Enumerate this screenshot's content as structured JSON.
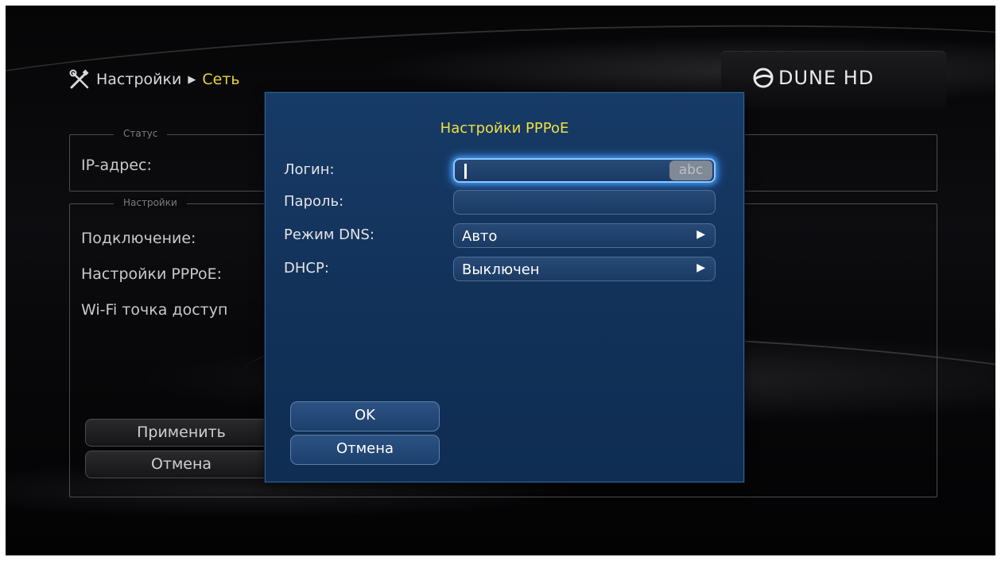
{
  "breadcrumb": {
    "root": "Настройки",
    "current": "Сеть",
    "separator": "▶",
    "icon": "tools-icon"
  },
  "brand": {
    "logo": "DUNE HD"
  },
  "background": {
    "status_group_title": "Статус",
    "ip_label": "IP-адрес:",
    "settings_group_title": "Настройки",
    "rows": [
      "Подключение:",
      "Настройки PPPoE:",
      "Wi-Fi точка доступ"
    ],
    "apply_label": "Применить",
    "cancel_label": "Отмена"
  },
  "dialog": {
    "title": "Настройки PPPoE",
    "login": {
      "label": "Логин:",
      "value": "",
      "input_mode": "abc"
    },
    "password": {
      "label": "Пароль:",
      "value": ""
    },
    "dns_mode": {
      "label": "Режим DNS:",
      "value": "Авто"
    },
    "dhcp": {
      "label": "DHCP:",
      "value": "Выключен"
    },
    "ok_label": "OK",
    "cancel_label": "Отмена"
  },
  "colors": {
    "accent_yellow": "#e8d23c",
    "dialog_blue": "#12325a",
    "focus_glow": "#3b8fe6"
  }
}
